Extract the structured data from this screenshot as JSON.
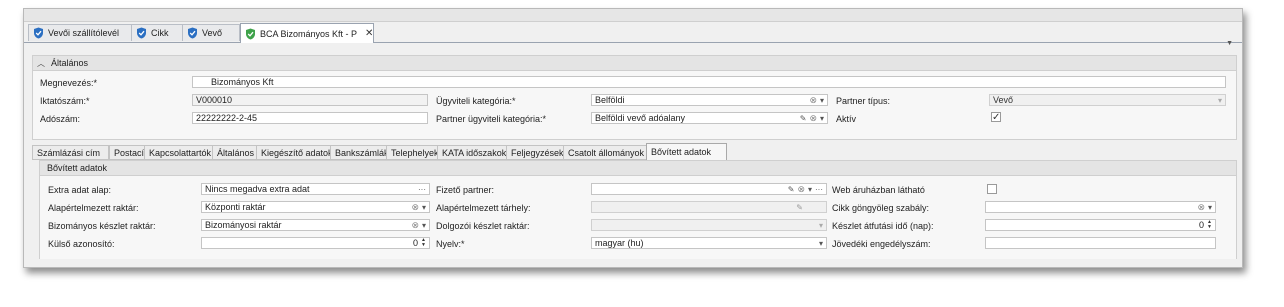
{
  "doc_tabs": [
    {
      "label": "Vevői szállítólevél",
      "active": false
    },
    {
      "label": "Cikk",
      "active": false
    },
    {
      "label": "Vevő",
      "active": false
    },
    {
      "label": "BCA Bizományos Kft - P",
      "active": true
    }
  ],
  "general": {
    "title": "Általános",
    "name_label": "Megnevezés:*",
    "name_value": "Bizományos Kft",
    "reg_label": "Iktatószám:*",
    "reg_value": "V000010",
    "tax_label": "Adószám:",
    "tax_value": "22222222-2-45",
    "cat_label": "Ügyviteli kategória:*",
    "cat_value": "Belföldi",
    "pcat_label": "Partner ügyviteli kategória:*",
    "pcat_value": "Belföldi vevő adóalany",
    "ptype_label": "Partner típus:",
    "ptype_value": "Vevő",
    "active_label": "Aktív",
    "active_checked": true
  },
  "page_tabs": [
    {
      "label": "Számlázási cím"
    },
    {
      "label": "Postacím"
    },
    {
      "label": "Kapcsolattartók"
    },
    {
      "label": "Általános"
    },
    {
      "label": "Kiegészítő adatok"
    },
    {
      "label": "Bankszámlák"
    },
    {
      "label": "Telephelyek"
    },
    {
      "label": "KATA időszakok"
    },
    {
      "label": "Feljegyzések"
    },
    {
      "label": "Csatolt állományok"
    },
    {
      "label": "Bővített adatok"
    }
  ],
  "ext": {
    "title": "Bővített adatok",
    "extra_label": "Extra adat alap:",
    "extra_value": "Nincs megadva extra adat",
    "wh_label": "Alapértelmezett raktár:",
    "wh_value": "Központi raktár",
    "cons_label": "Bizományos készlet raktár:",
    "cons_value": "Bizományosi raktár",
    "extid_label": "Külső azonosító:",
    "extid_value": "0",
    "payer_label": "Fizető partner:",
    "payer_value": "",
    "defstore_label": "Alapértelmezett tárhely:",
    "emp_label": "Dolgozói készlet raktár:",
    "lang_label": "Nyelv:*",
    "lang_value": "magyar (hu)",
    "web_label": "Web áruházban látható",
    "web_checked": false,
    "roll_label": "Cikk göngyöleg szabály:",
    "lead_label": "Készlet átfutási idő (nap):",
    "lead_value": "0",
    "excise_label": "Jövedéki engedélyszám:",
    "excise_value": ""
  },
  "icons": {
    "clear": "clear-circle-icon",
    "dropdown": "chevron-down-icon",
    "more": "ellipsis-icon",
    "edit": "pencil-icon",
    "close": "close-icon"
  },
  "colors": {
    "shield_blue": "#2b6fc2",
    "shield_green": "#3ea24a"
  }
}
